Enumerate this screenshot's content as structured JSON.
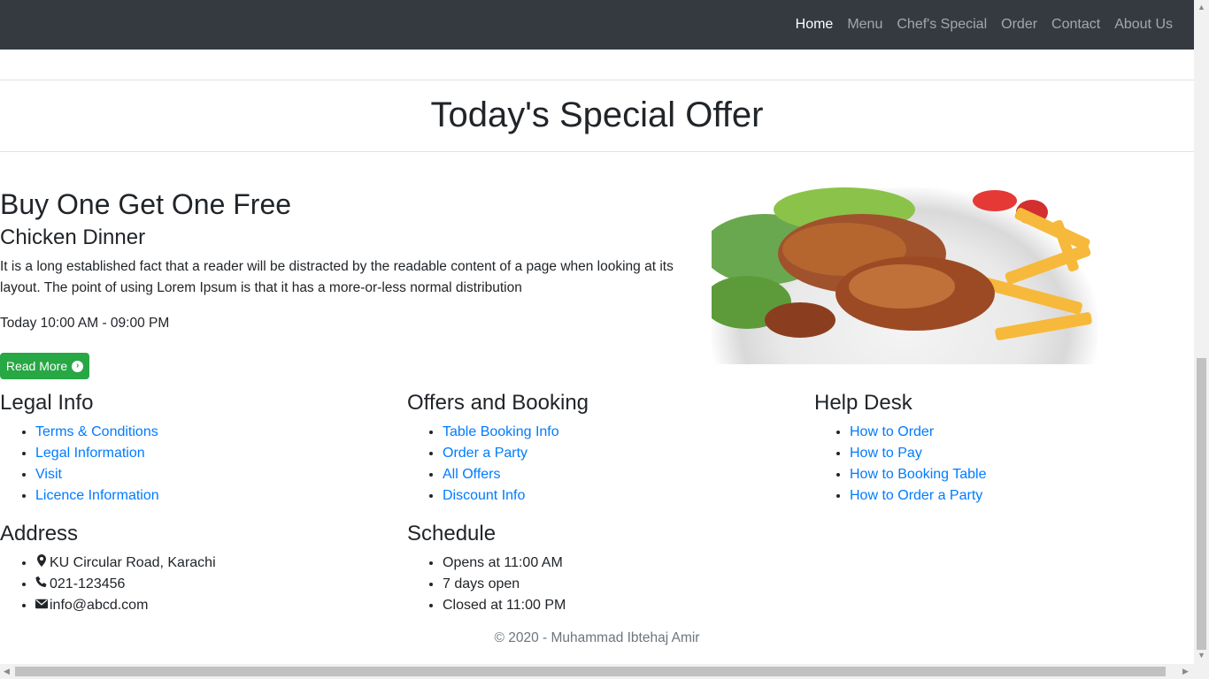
{
  "nav": {
    "items": [
      "Home",
      "Menu",
      "Chef's Special",
      "Order",
      "Contact",
      "About Us"
    ],
    "active": "Home"
  },
  "offer": {
    "title": "Today's Special Offer"
  },
  "promo": {
    "heading": "Buy One Get One Free",
    "subheading": "Chicken Dinner",
    "text": "It is a long established fact that a reader will be distracted by the readable content of a page when looking at its layout. The point of using Lorem Ipsum is that it has a more-or-less normal distribution",
    "hours": "Today 10:00 AM - 09:00 PM",
    "button": "Read More"
  },
  "legal": {
    "title": "Legal Info",
    "links": [
      "Terms & Conditions",
      "Legal Information",
      "Visit",
      "Licence Information"
    ]
  },
  "offers": {
    "title": "Offers and Booking",
    "links": [
      "Table Booking Info",
      "Order a Party",
      "All Offers",
      "Discount Info"
    ]
  },
  "help": {
    "title": "Help Desk",
    "links": [
      "How to Order",
      "How to Pay",
      "How to Booking Table",
      "How to Order a Party"
    ]
  },
  "address": {
    "title": "Address",
    "location": "KU Circular Road, Karachi",
    "phone": "021-123456",
    "email": "info@abcd.com"
  },
  "schedule": {
    "title": "Schedule",
    "items": [
      "Opens at 11:00 AM",
      "7 days open",
      "Closed at 11:00 PM"
    ]
  },
  "footer": {
    "text": "© 2020 - Muhammad Ibtehaj Amir"
  },
  "colors": {
    "navbar": "#343a40",
    "link": "#007bff",
    "button": "#28a745"
  }
}
